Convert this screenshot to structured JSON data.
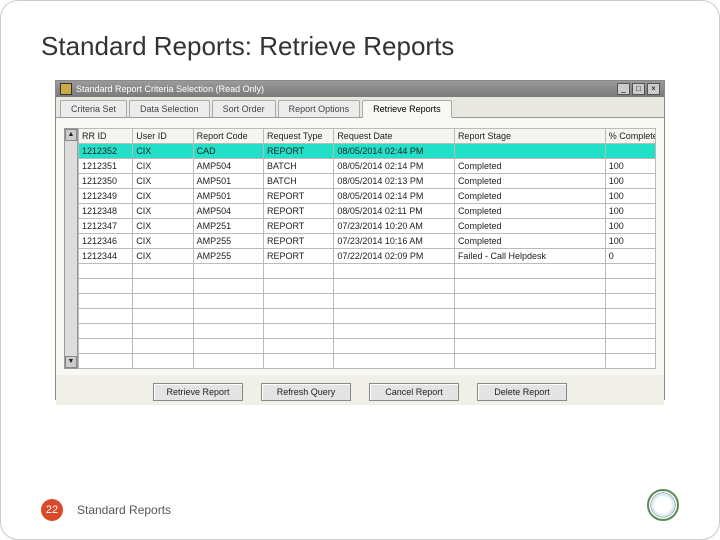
{
  "slide": {
    "title": "Standard Reports: Retrieve Reports",
    "footer_label": "Standard Reports",
    "page_number": "22"
  },
  "window": {
    "title": "Standard Report Criteria Selection  (Read Only)",
    "min": "_",
    "max": "□",
    "close": "×"
  },
  "tabs": {
    "t0": "Criteria Set",
    "t1": "Data Selection",
    "t2": "Sort Order",
    "t3": "Report Options",
    "t4": "Retrieve Reports"
  },
  "headers": {
    "rr_id": "RR ID",
    "user_id": "User ID",
    "report_code": "Report Code",
    "request_type": "Request Type",
    "request_date": "Request Date",
    "report_stage": "Report Stage",
    "pct_complete": "% Complete"
  },
  "table": {
    "rows": [
      {
        "rr": "1212352",
        "user": "CIX",
        "code": "CAD",
        "type": "REPORT",
        "date": "08/05/2014 02:44 PM",
        "stage": "",
        "pct": ""
      },
      {
        "rr": "1212351",
        "user": "CIX",
        "code": "AMP504",
        "type": "BATCH",
        "date": "08/05/2014 02:14 PM",
        "stage": "Completed",
        "pct": "100"
      },
      {
        "rr": "1212350",
        "user": "CIX",
        "code": "AMP501",
        "type": "BATCH",
        "date": "08/05/2014 02:13 PM",
        "stage": "Completed",
        "pct": "100"
      },
      {
        "rr": "1212349",
        "user": "CIX",
        "code": "AMP501",
        "type": "REPORT",
        "date": "08/05/2014 02:14 PM",
        "stage": "Completed",
        "pct": "100"
      },
      {
        "rr": "1212348",
        "user": "CIX",
        "code": "AMP504",
        "type": "REPORT",
        "date": "08/05/2014 02:11 PM",
        "stage": "Completed",
        "pct": "100"
      },
      {
        "rr": "1212347",
        "user": "CIX",
        "code": "AMP251",
        "type": "REPORT",
        "date": "07/23/2014 10:20 AM",
        "stage": "Completed",
        "pct": "100"
      },
      {
        "rr": "1212346",
        "user": "CIX",
        "code": "AMP255",
        "type": "REPORT",
        "date": "07/23/2014 10:16 AM",
        "stage": "Completed",
        "pct": "100"
      },
      {
        "rr": "1212344",
        "user": "CIX",
        "code": "AMP255",
        "type": "REPORT",
        "date": "07/22/2014 02:09 PM",
        "stage": "Failed - Call Helpdesk",
        "pct": "0"
      }
    ]
  },
  "buttons": {
    "retrieve": "Retrieve Report",
    "refresh": "Refresh Query",
    "cancel": "Cancel Report",
    "delete": "Delete Report"
  },
  "scroll": {
    "up": "▲",
    "down": "▼"
  }
}
